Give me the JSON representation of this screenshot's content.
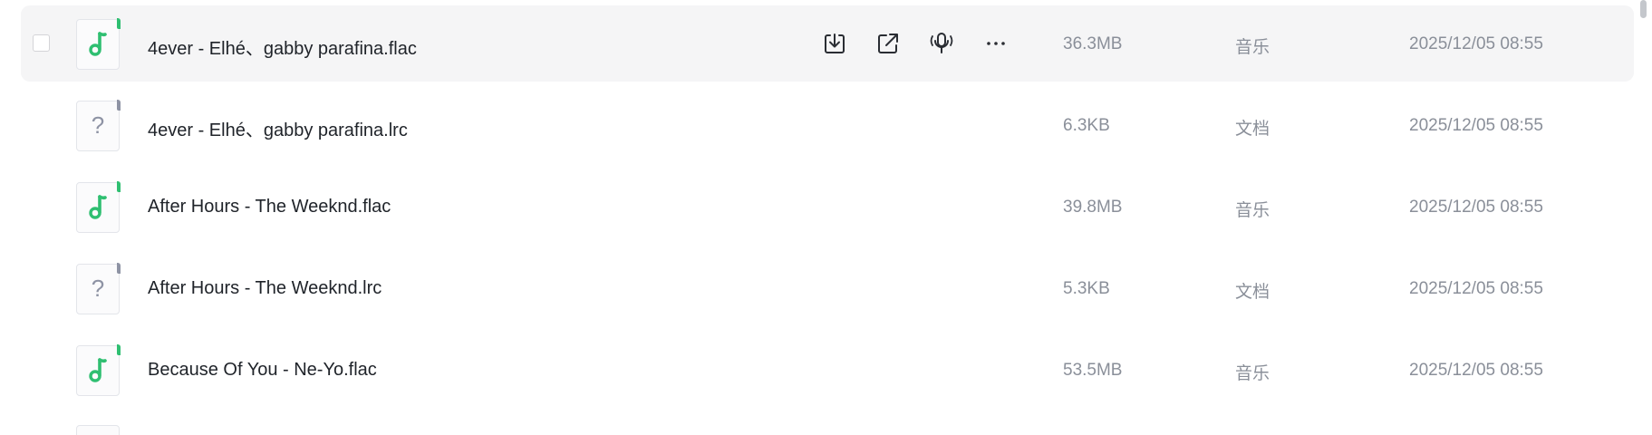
{
  "colors": {
    "music_accent": "#2fbf71",
    "doc_accent": "#8e93a4",
    "hover_background": "#f5f5f6",
    "text_primary": "#1f2329",
    "text_secondary": "#8a8f99"
  },
  "row_actions": {
    "download": {
      "icon": "download-icon"
    },
    "share": {
      "icon": "share-icon"
    },
    "listen": {
      "icon": "podcast-icon"
    },
    "more": {
      "icon": "more-icon",
      "label": "···"
    }
  },
  "files": [
    {
      "name": "4ever - Elhé、gabby parafina.flac",
      "size": "36.3MB",
      "type": "音乐",
      "modified": "2025/12/05 08:55",
      "icon": "music-note-icon",
      "hovered": true
    },
    {
      "name": "4ever - Elhé、gabby parafina.lrc",
      "size": "6.3KB",
      "type": "文档",
      "modified": "2025/12/05 08:55",
      "icon": "unknown-file-icon",
      "hovered": false
    },
    {
      "name": "After Hours - The Weeknd.flac",
      "size": "39.8MB",
      "type": "音乐",
      "modified": "2025/12/05 08:55",
      "icon": "music-note-icon",
      "hovered": false
    },
    {
      "name": "After Hours - The Weeknd.lrc",
      "size": "5.3KB",
      "type": "文档",
      "modified": "2025/12/05 08:55",
      "icon": "unknown-file-icon",
      "hovered": false
    },
    {
      "name": "Because Of You - Ne-Yo.flac",
      "size": "53.5MB",
      "type": "音乐",
      "modified": "2025/12/05 08:55",
      "icon": "music-note-icon",
      "hovered": false
    }
  ]
}
